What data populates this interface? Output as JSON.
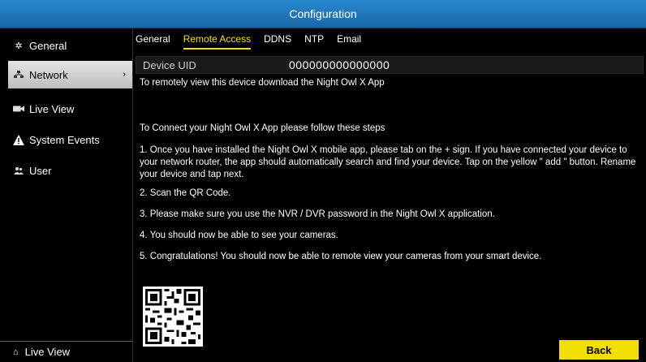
{
  "window": {
    "title": "Configuration"
  },
  "sidebar": {
    "items": [
      {
        "label": "General",
        "icon": "gear-icon"
      },
      {
        "label": "Network",
        "icon": "network-icon",
        "active": true
      },
      {
        "label": "Live View",
        "icon": "camera-icon"
      },
      {
        "label": "System Events",
        "icon": "warning-icon"
      },
      {
        "label": "User",
        "icon": "users-icon"
      }
    ],
    "bottom": {
      "label": "Live View",
      "icon": "home-icon"
    }
  },
  "tabs": [
    {
      "label": "General"
    },
    {
      "label": "Remote Access",
      "active": true
    },
    {
      "label": "DDNS"
    },
    {
      "label": "NTP"
    },
    {
      "label": "Email"
    }
  ],
  "device_uid": {
    "label": "Device UID",
    "value": "000000000000000"
  },
  "instructions": {
    "download_note": "To remotely view this device download the Night Owl X App",
    "heading": "To Connect your Night Owl X App please follow these steps",
    "steps": [
      "1. Once you have installed the Night Owl X mobile app, please tab on the + sign.  If you have connected your device to your network router, the app should automatically search and find your device. Tap on the yellow \" add \" button. Rename your device  and tap next.",
      "2. Scan the QR Code.",
      "3. Please make sure you use the NVR / DVR  password in the Night Owl X application.",
      "4. You should now be able to see your cameras.",
      "5. Congratulations! You should now be able to remote view your cameras from your smart device."
    ]
  },
  "back_button": {
    "label": "Back"
  },
  "colors": {
    "titlebar": "#1e78be",
    "accent_yellow": "#f4e000",
    "background": "#000000"
  }
}
